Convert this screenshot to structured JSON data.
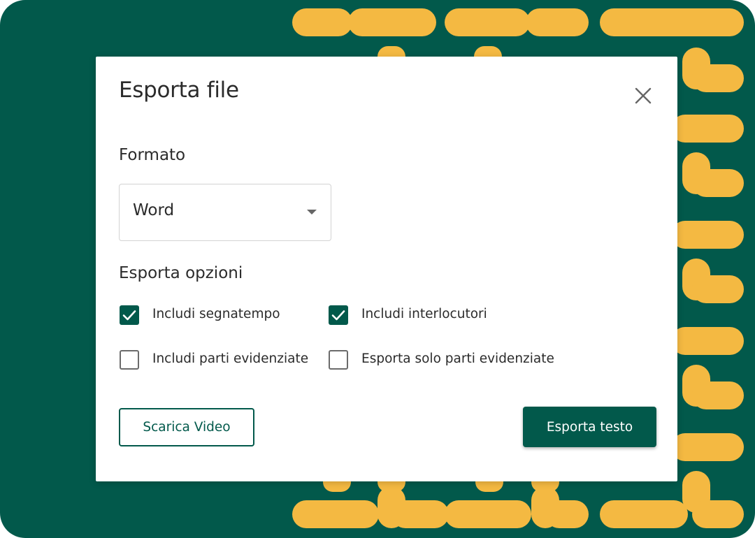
{
  "colors": {
    "brand_green": "#02594b",
    "pattern_yellow": "#f4b942",
    "text": "#2b2b2b"
  },
  "dialog": {
    "title": "Esporta file",
    "close_icon": "close-icon",
    "format_label": "Formato",
    "format_select": {
      "selected": "Word",
      "icon": "caret-down-icon"
    },
    "options_label": "Esporta opzioni",
    "options": [
      {
        "label": "Includi segnatempo",
        "checked": true
      },
      {
        "label": "Includi interlocutori",
        "checked": true
      },
      {
        "label": "Includi parti evidenziate",
        "checked": false
      },
      {
        "label": "Esporta solo parti evidenziate",
        "checked": false
      }
    ],
    "secondary_button": "Scarica Video",
    "primary_button": "Esporta testo"
  }
}
